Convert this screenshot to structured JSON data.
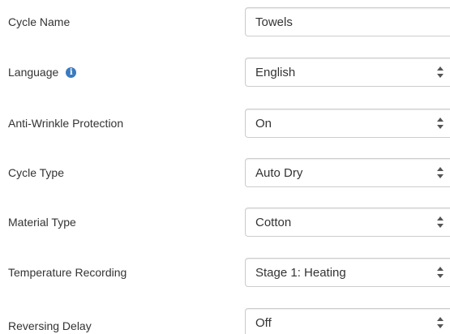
{
  "fields": [
    {
      "label": "Cycle Name",
      "type": "text",
      "value": "Towels"
    },
    {
      "label": "Language",
      "type": "select",
      "value": "English",
      "has_info_icon": true
    },
    {
      "label": "Anti-Wrinkle Protection",
      "type": "select",
      "value": "On"
    },
    {
      "label": "Cycle Type",
      "type": "select",
      "value": "Auto Dry"
    },
    {
      "label": "Material Type",
      "type": "select",
      "value": "Cotton"
    },
    {
      "label": "Temperature Recording",
      "type": "select",
      "value": "Stage 1: Heating"
    },
    {
      "label": "Reversing Delay",
      "type": "select",
      "value": "Off"
    }
  ],
  "colors": {
    "label_text": "#333333",
    "border": "#cccccc",
    "info_icon": "#3b7bbf"
  },
  "icons": {
    "info": "info-circle-icon",
    "select_arrows": "up-down-arrows-icon"
  }
}
